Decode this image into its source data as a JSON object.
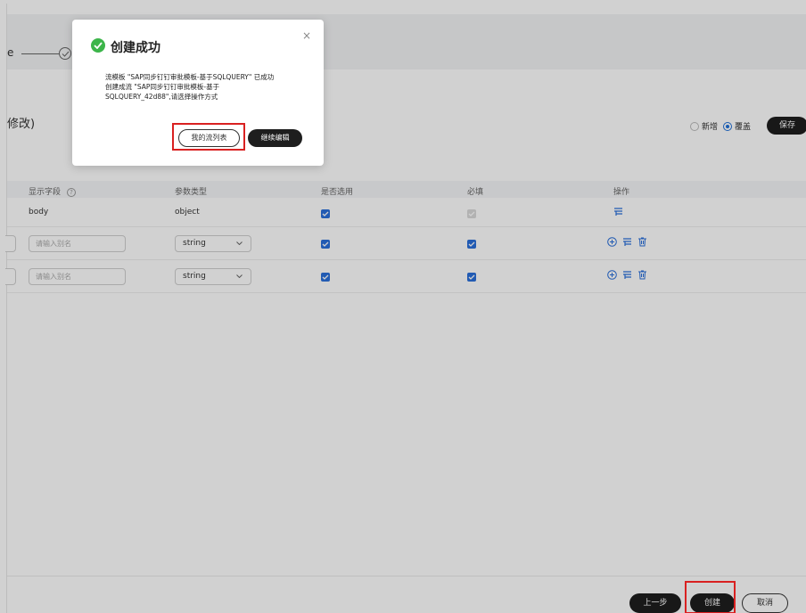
{
  "steps": {
    "tail_text": "e"
  },
  "section": {
    "title": "修改)"
  },
  "mode": {
    "options": [
      "新增",
      "覆盖"
    ],
    "selected": "覆盖",
    "save_label": "保存"
  },
  "table": {
    "headers": [
      "显示字段",
      "参数类型",
      "是否选用",
      "必填",
      "操作"
    ],
    "help_glyph": "?",
    "rows": [
      {
        "field": "body",
        "type": "object",
        "selected": true,
        "required": true,
        "required_disabled": true
      },
      {
        "field_placeholder": "请输入别名",
        "type": "string",
        "selected": true,
        "required": true
      },
      {
        "field_placeholder": "请输入别名",
        "type": "string",
        "selected": true,
        "required": true
      }
    ]
  },
  "footer": {
    "prev_label": "上一步",
    "create_label": "创建",
    "cancel_label": "取消"
  },
  "modal": {
    "title": "创建成功",
    "close_glyph": "×",
    "message_lines": [
      "流模板 \"SAP同步钉钉审批模板-基于SQLQUERY\" 已成功",
      "创建成流 \"SAP同步钉钉审批模板-基于",
      "SQLQUERY_42d88\",请选择操作方式"
    ],
    "list_button": "我的流列表",
    "edit_button": "继续编辑"
  },
  "colors": {
    "accent": "#2a6fdb",
    "success": "#3cb54a",
    "dark_button": "#1e1e1e",
    "highlight": "#d92121"
  }
}
